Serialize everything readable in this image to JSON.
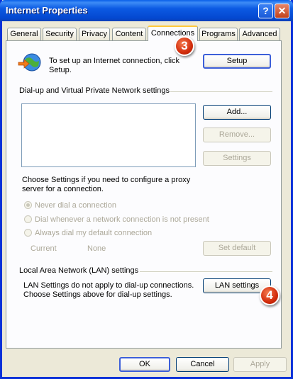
{
  "window": {
    "title": "Internet Properties"
  },
  "tabs": [
    "General",
    "Security",
    "Privacy",
    "Content",
    "Connections",
    "Programs",
    "Advanced"
  ],
  "setup": {
    "text": "To set up an Internet connection, click Setup.",
    "button": "Setup"
  },
  "dialup": {
    "group_label": "Dial-up and Virtual Private Network settings",
    "add_button": "Add...",
    "remove_button": "Remove...",
    "settings_button": "Settings",
    "proxy_text": "Choose Settings if you need to configure a proxy server for a connection.",
    "radios": [
      "Never dial a connection",
      "Dial whenever a network connection is not present",
      "Always dial my default connection"
    ],
    "current_label": "Current",
    "current_value": "None",
    "set_default_button": "Set default"
  },
  "lan": {
    "group_label": "Local Area Network (LAN) settings",
    "text": "LAN Settings do not apply to dial-up connections. Choose Settings above for dial-up settings.",
    "button": "LAN settings"
  },
  "footer": {
    "ok": "OK",
    "cancel": "Cancel",
    "apply": "Apply"
  },
  "badges": {
    "tab_badge": "3",
    "lan_badge": "4"
  },
  "icons": {
    "help": "?",
    "close": "✕"
  }
}
